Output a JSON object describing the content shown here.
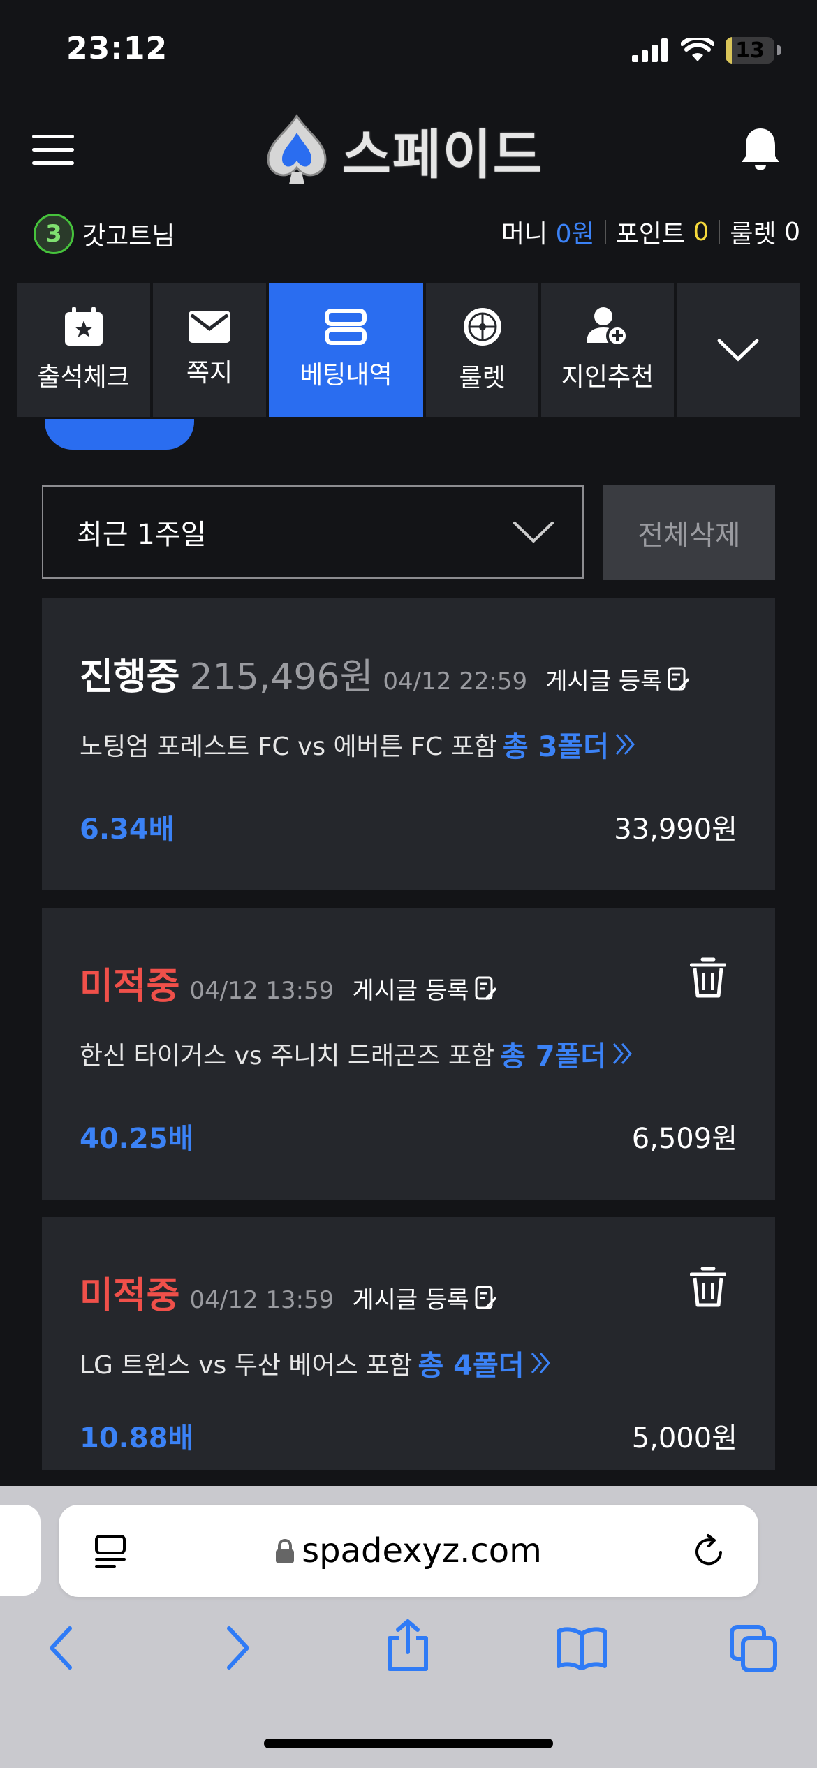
{
  "status_bar": {
    "time": "23:12",
    "battery": "13",
    "battery_level": 0.13
  },
  "header": {
    "logo_text": "스페이드"
  },
  "user": {
    "level": "3",
    "name": "갓고트님",
    "money_label": "머니",
    "money_value": "0원",
    "point_label": "포인트",
    "point_value": "0",
    "roulette_label": "룰렛",
    "roulette_value": "0"
  },
  "tabs": [
    {
      "label": "출석체크",
      "icon": "calendar-star-icon"
    },
    {
      "label": "쪽지",
      "icon": "envelope-icon"
    },
    {
      "label": "베팅내역",
      "icon": "list-icon",
      "active": true
    },
    {
      "label": "룰렛",
      "icon": "roulette-icon"
    },
    {
      "label": "지인추천",
      "icon": "user-plus-icon"
    }
  ],
  "filter": {
    "period": "최근 1주일",
    "delete_all": "전체삭제"
  },
  "bets": [
    {
      "status": "진행중",
      "amount": "215,496원",
      "date": "04/12 22:59",
      "post_label": "게시글 등록",
      "match": "노팅엄 포레스트 FC vs 에버튼 FC 포함",
      "folds": "총 3폴더",
      "odds": "6.34배",
      "stake": "33,990원"
    },
    {
      "status": "미적중",
      "date": "04/12 13:59",
      "post_label": "게시글 등록",
      "match": "한신 타이거스 vs 주니치 드래곤즈 포함",
      "folds": "총 7폴더",
      "odds": "40.25배",
      "stake": "6,509원"
    },
    {
      "status": "미적중",
      "date": "04/12 13:59",
      "post_label": "게시글 등록",
      "match": "LG 트윈스 vs 두산 베어스 포함",
      "folds": "총 4폴더",
      "odds": "10.88배",
      "stake": "5,000원"
    }
  ],
  "browser": {
    "url": "spadexyz.com"
  },
  "colors": {
    "accent": "#2a6df0",
    "in_progress": "#ffffff",
    "lost": "#f0504a",
    "odds": "#3b82f6",
    "point": "#f5d83b"
  }
}
